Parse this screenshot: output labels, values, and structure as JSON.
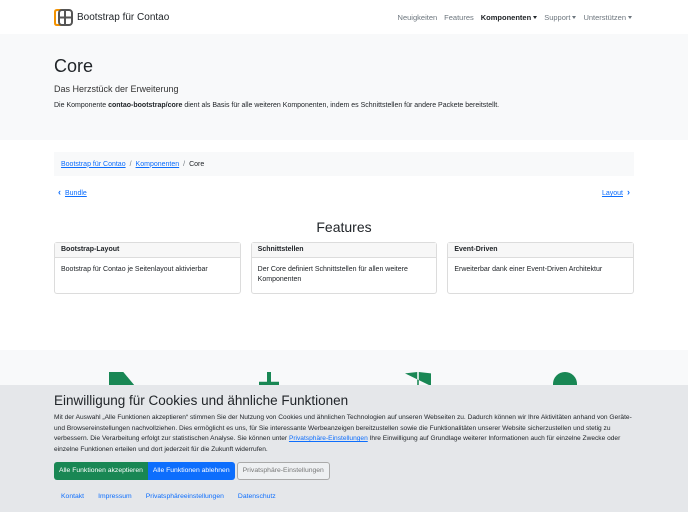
{
  "nav": {
    "brand": "Bootstrap für Contao",
    "items": [
      {
        "label": "Neuigkeiten"
      },
      {
        "label": "Features"
      },
      {
        "label": "Komponenten",
        "active": true,
        "dropdown": true
      },
      {
        "label": "Support",
        "dropdown": true
      },
      {
        "label": "Unterstützen",
        "dropdown": true
      }
    ]
  },
  "hero": {
    "title": "Core",
    "lead": "Das Herzstück der Erweiterung",
    "desc_pre": "Die Komponente ",
    "desc_bold": "contao-bootstrap/core",
    "desc_post": " dient als Basis für alle weiteren Komponenten, indem es Schnittstellen für andere Packete bereitstellt."
  },
  "breadcrumb": [
    "Bootstrap für Contao",
    "Komponenten",
    "Core"
  ],
  "pager": {
    "prev": "Bundle",
    "next": "Layout"
  },
  "features": {
    "title": "Features",
    "cards": [
      {
        "title": "Bootstrap-Layout",
        "body": "Bootstrap für Contao je Seitenlayout aktivierbar"
      },
      {
        "title": "Schnittstellen",
        "body": "Der Core definiert Schnittstellen für allen weitere Komponenten"
      },
      {
        "title": "Event-Driven",
        "body": "Erweiterbar dank einer Event-Driven Architektur"
      }
    ]
  },
  "cookie": {
    "title": "Einwilligung für Cookies und ähnliche Funktionen",
    "text_pre": "Mit der Auswahl „Alle Funktionen akzeptieren“ stimmen Sie der Nutzung von Cookies und ähnlichen Technologien auf unseren Webseiten zu. Dadurch können wir Ihre Aktivitäten anhand von Geräte- und Browsereinstellungen nachvollziehen. Dies ermöglicht es uns, für Sie interessante Werbeanzeigen bereitzustellen sowie die Funktionalitäten unserer Website sicherzustellen und stetig zu verbessern. Die Verarbeitung erfolgt zur statistischen Analyse. Sie können unter ",
    "link": "Privatsphäre-Einstellungen",
    "text_post": " Ihre Einwilligung auf Grundlage weiterer Informationen auch für einzelne Zwecke oder einzelne Funktionen erteilen und dort jederzeit für die Zukunft widerrufen.",
    "accept": "Alle Funktionen akzeptieren",
    "reject": "Alle Funktionen ablehnen",
    "settings": "Privatsphäre-Einstellungen"
  },
  "footer": [
    "Kontakt",
    "Impressum",
    "Privatsphäreeinstellungen",
    "Datenschutz"
  ],
  "colors": {
    "accent": "#198754",
    "primary": "#0d6efd",
    "logo": "#f39200"
  }
}
